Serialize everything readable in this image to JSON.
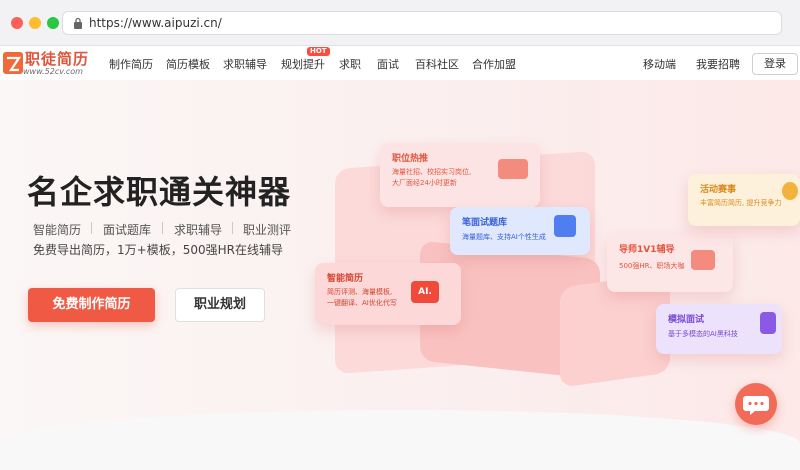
{
  "browser": {
    "url": "https://www.aipuzi.cn/"
  },
  "header": {
    "logo_text": "职徒简历",
    "logo_sub": "www.52cv.com",
    "nav": [
      "制作简历",
      "简历模板",
      "求职辅导",
      "规划提升",
      "求职",
      "面试",
      "百科社区",
      "合作加盟"
    ],
    "hot_badge": "HOT",
    "mobile": "移动端",
    "recruit": "我要招聘",
    "login": "登录"
  },
  "hero": {
    "title": "名企求职通关神器",
    "features": [
      "智能简历",
      "面试题库",
      "求职辅导",
      "职业测评"
    ],
    "desc": "免费导出简历，1万+模板，500强HR在线辅导",
    "primary_btn": "免费制作简历",
    "secondary_btn": "职业规划"
  },
  "cards": {
    "job": {
      "title": "职位热推",
      "line1": "海量社招、校招实习岗位,",
      "line2": "大厂面经24小时更新"
    },
    "exam": {
      "title": "笔面试题库",
      "line1": "海量题库、支持AI个性生成"
    },
    "resume": {
      "title": "智能简历",
      "line1": "简历评测、海量模板,",
      "line2": "一键翻译、AI优化代写",
      "icon_text": "AI."
    },
    "mentor": {
      "title": "导师1V1辅导",
      "line1": "500强HR、职场大咖"
    },
    "event": {
      "title": "活动赛事",
      "line1": "丰富简历简历, 提升竞争力"
    },
    "mock": {
      "title": "模拟面试",
      "line1": "基于多模态的AI黑科技"
    }
  },
  "colors": {
    "brand": "#f05a45",
    "chat": "#f26b58"
  },
  "icons": [
    "lock-icon",
    "logo-icon",
    "chat-icon"
  ]
}
